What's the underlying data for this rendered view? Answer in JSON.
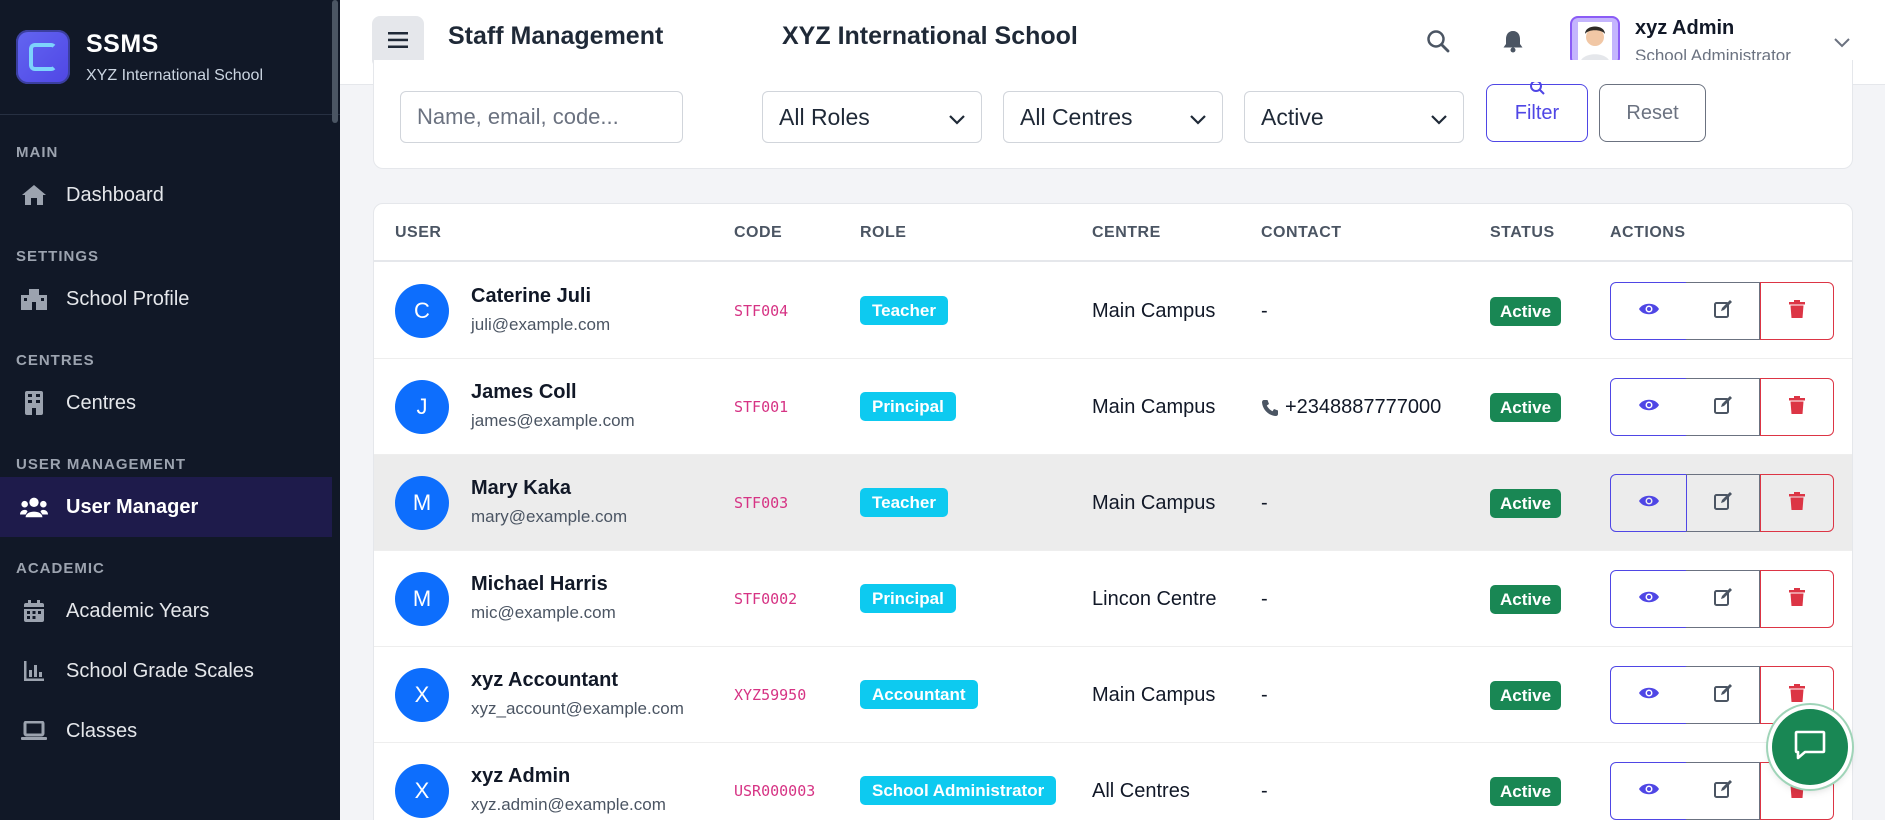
{
  "app": {
    "name": "SSMS",
    "school": "XYZ International School"
  },
  "sidebar": {
    "sections": [
      {
        "label": "MAIN",
        "items": [
          {
            "label": "Dashboard",
            "icon": "home-icon"
          }
        ]
      },
      {
        "label": "SETTINGS",
        "items": [
          {
            "label": "School Profile",
            "icon": "school-icon"
          }
        ]
      },
      {
        "label": "CENTRES",
        "items": [
          {
            "label": "Centres",
            "icon": "building-icon"
          }
        ]
      },
      {
        "label": "USER MANAGEMENT",
        "items": [
          {
            "label": "User Manager",
            "icon": "users-icon",
            "active": true
          }
        ]
      },
      {
        "label": "ACADEMIC",
        "items": [
          {
            "label": "Academic Years",
            "icon": "calendar-icon"
          },
          {
            "label": "School Grade Scales",
            "icon": "chart-icon"
          },
          {
            "label": "Classes",
            "icon": "laptop-icon"
          }
        ]
      }
    ]
  },
  "header": {
    "title": "Staff Management",
    "school": "XYZ International School",
    "user_name": "xyz Admin",
    "user_role": "School Administrator"
  },
  "filters": {
    "search_placeholder": "Name, email, code...",
    "role": "All Roles",
    "centre": "All Centres",
    "status": "Active",
    "filter_label": "Filter",
    "reset_label": "Reset"
  },
  "table": {
    "columns": [
      "USER",
      "CODE",
      "ROLE",
      "CENTRE",
      "CONTACT",
      "STATUS",
      "ACTIONS"
    ],
    "rows": [
      {
        "initial": "C",
        "name": "Caterine Juli",
        "email": "juli@example.com",
        "code": "STF004",
        "role": "Teacher",
        "centre": "Main Campus",
        "contact": "-",
        "status": "Active"
      },
      {
        "initial": "J",
        "name": "James Coll",
        "email": "james@example.com",
        "code": "STF001",
        "role": "Principal",
        "centre": "Main Campus",
        "contact": "+2348887777000",
        "status": "Active"
      },
      {
        "initial": "M",
        "name": "Mary Kaka",
        "email": "mary@example.com",
        "code": "STF003",
        "role": "Teacher",
        "centre": "Main Campus",
        "contact": "-",
        "status": "Active"
      },
      {
        "initial": "M",
        "name": "Michael Harris",
        "email": "mic@example.com",
        "code": "STF0002",
        "role": "Principal",
        "centre": "Lincon Centre",
        "contact": "-",
        "status": "Active"
      },
      {
        "initial": "X",
        "name": "xyz Accountant",
        "email": "xyz_account@example.com",
        "code": "XYZ59950",
        "role": "Accountant",
        "centre": "Main Campus",
        "contact": "-",
        "status": "Active"
      },
      {
        "initial": "X",
        "name": "xyz Admin",
        "email": "xyz.admin@example.com",
        "code": "USR000003",
        "role": "School Administrator",
        "centre": "All Centres",
        "contact": "-",
        "status": "Active"
      }
    ]
  },
  "colors": {
    "sidebar_bg": "#111827",
    "accent": "#4f46e5",
    "role_badge": "#0dcaf0",
    "status_active": "#198754",
    "avatar": "#0d6efd",
    "danger": "#dc3545"
  }
}
